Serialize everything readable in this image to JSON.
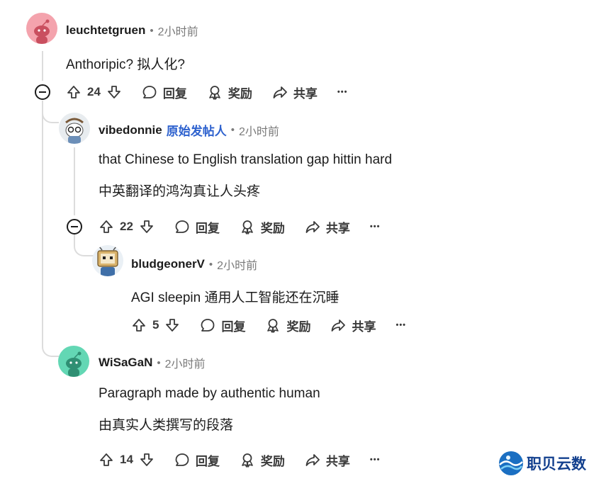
{
  "comments": [
    {
      "username": "leuchtetgruen",
      "time": "2小时前",
      "lines": [
        "Anthoripic?   拟人化?"
      ],
      "score": "24"
    },
    {
      "username": "vibedonnie",
      "op_badge": "原始发帖人",
      "time": "2小时前",
      "lines": [
        "that Chinese to English translation gap hittin hard",
        "中英翻译的鸿沟真让人头疼"
      ],
      "score": "22"
    },
    {
      "username": "bludgeonerV",
      "time": "2小时前",
      "lines": [
        "AGI sleepin   通用人工智能还在沉睡"
      ],
      "score": "5"
    },
    {
      "username": "WiSaGaN",
      "time": "2小时前",
      "lines": [
        "Paragraph made by authentic human",
        "由真实人类撰写的段落"
      ],
      "score": "14"
    }
  ],
  "actions": {
    "reply": "回复",
    "award": "奖励",
    "share": "共享",
    "more": "•••"
  },
  "meta_dot": "•",
  "watermark": "职贝云数",
  "colors": {
    "op_badge": "#2d61ce",
    "avatar_1": "#f4a3ad",
    "avatar_4": "#63d7b4",
    "thread_line": "#dcdcdc",
    "watermark": "#13408e"
  }
}
